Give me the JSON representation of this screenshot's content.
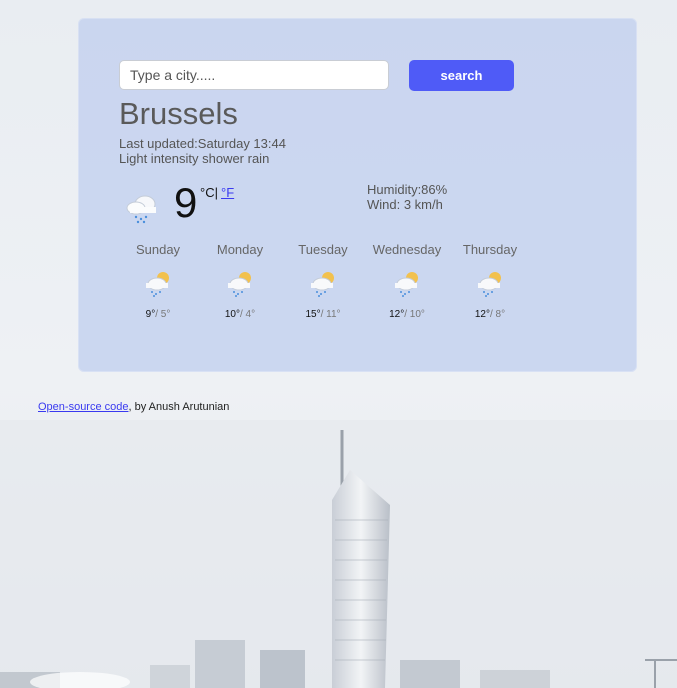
{
  "search": {
    "placeholder": "Type a city.....",
    "button_label": "search"
  },
  "current": {
    "city": "Brussels",
    "last_updated": "Last updated:Saturday 13:44",
    "description": "Light intensity shower rain",
    "temperature": "9",
    "unit_celsius": "°C|",
    "unit_fahrenheit": "°F",
    "humidity": "Humidity:86%",
    "wind": "Wind: 3 km/h",
    "icon": "cloud-rain-icon"
  },
  "forecast": [
    {
      "day": "Sunday",
      "max": "9°",
      "min": "/ 5°",
      "icon": "sun-cloud-rain-icon"
    },
    {
      "day": "Monday",
      "max": "10°",
      "min": "/ 4°",
      "icon": "sun-cloud-rain-icon"
    },
    {
      "day": "Tuesday",
      "max": "15°",
      "min": "/ 11°",
      "icon": "sun-cloud-rain-icon"
    },
    {
      "day": "Wednesday",
      "max": "12°",
      "min": "/ 10°",
      "icon": "sun-cloud-rain-icon"
    },
    {
      "day": "Thursday",
      "max": "12°",
      "min": "/ 8°",
      "icon": "sun-cloud-rain-icon"
    }
  ],
  "footer": {
    "link_text": "Open-source code",
    "by_text": ", by Anush Arutunian"
  },
  "colors": {
    "accent": "#4f5bf7",
    "link": "#3a3af0",
    "card": "#c1cfee"
  }
}
